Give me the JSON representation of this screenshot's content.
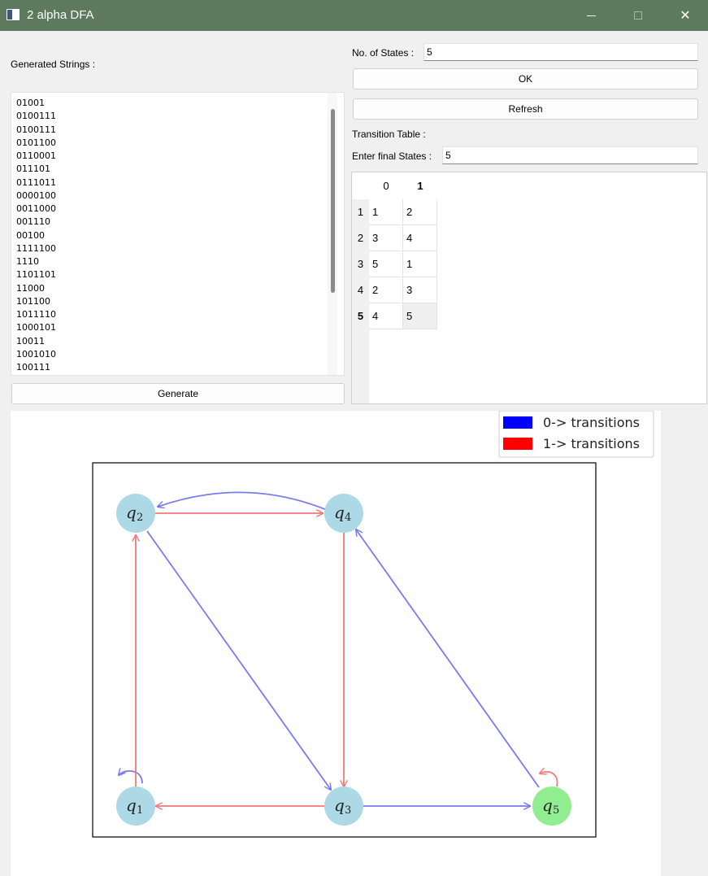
{
  "window": {
    "title": "2 alpha DFA",
    "close_glyph": "✕"
  },
  "left": {
    "generated_label": "Generated Strings :",
    "strings": [
      "01001",
      "0100111",
      "0100111",
      "0101100",
      "0110001",
      "011101",
      "0111011",
      "0000100",
      "0011000",
      "001110",
      "00100",
      "1111100",
      "1110",
      "1101101",
      "11000",
      "101100",
      "1011110",
      "1000101",
      "10011",
      "1001010",
      "100111"
    ],
    "generate_button": "Generate"
  },
  "right": {
    "states_label": "No. of States :",
    "states_value": "5",
    "ok_button": "OK",
    "refresh_button": "Refresh",
    "transition_label": "Transition Table :",
    "final_label": "Enter final States :",
    "final_value": "5",
    "table": {
      "columns": [
        "0",
        "1"
      ],
      "row_headers": [
        "1",
        "2",
        "3",
        "4",
        "5"
      ],
      "rows": [
        [
          "1",
          "2"
        ],
        [
          "3",
          "4"
        ],
        [
          "5",
          "1"
        ],
        [
          "2",
          "3"
        ],
        [
          "4",
          "5"
        ]
      ]
    }
  },
  "graph": {
    "legend": [
      {
        "text": "0-> transitions",
        "color": "#0000ff"
      },
      {
        "text": "1-> transitions",
        "color": "#ff0000"
      }
    ],
    "colors": {
      "zero_edge": "#7a7aee",
      "one_edge": "#f07a7a",
      "state_fill": "#add8e6",
      "final_fill": "#90ee90"
    },
    "states": [
      {
        "name": "q",
        "sub": "1"
      },
      {
        "name": "q",
        "sub": "2"
      },
      {
        "name": "q",
        "sub": "3"
      },
      {
        "name": "q",
        "sub": "4"
      },
      {
        "name": "q",
        "sub": "5"
      }
    ]
  }
}
